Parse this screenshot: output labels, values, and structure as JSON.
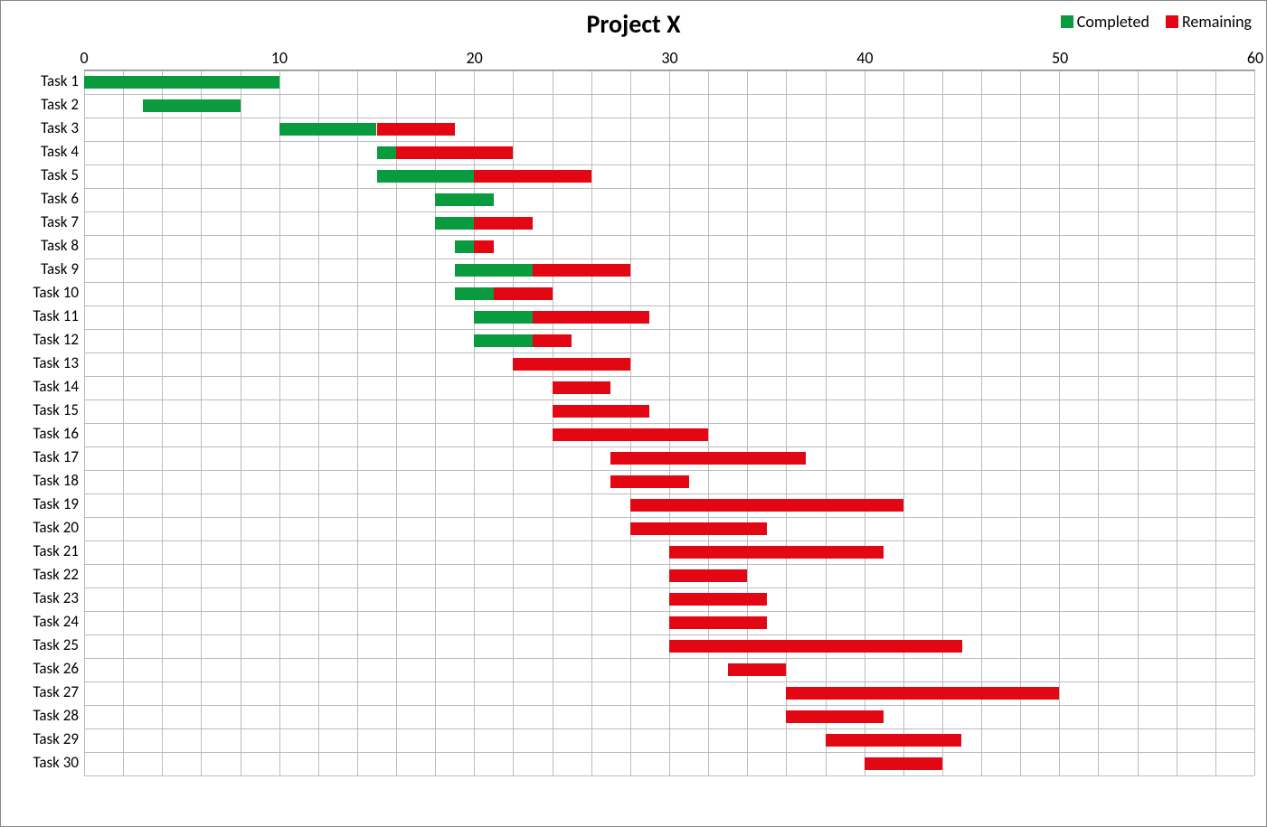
{
  "chart_data": {
    "type": "bar",
    "orientation": "horizontal_stacked_gantt",
    "title": "Project X",
    "xlabel": "",
    "ylabel": "",
    "xlim": [
      0,
      60
    ],
    "x_ticks": [
      0,
      10,
      20,
      30,
      40,
      50,
      60
    ],
    "x_minor_step": 2,
    "legend": [
      {
        "name": "Completed",
        "color": "#0a9b3e"
      },
      {
        "name": "Remaining",
        "color": "#e30613"
      }
    ],
    "categories": [
      "Task 1",
      "Task 2",
      "Task 3",
      "Task 4",
      "Task 5",
      "Task 6",
      "Task 7",
      "Task 8",
      "Task 9",
      "Task 10",
      "Task 11",
      "Task 12",
      "Task 13",
      "Task 14",
      "Task 15",
      "Task 16",
      "Task 17",
      "Task 18",
      "Task 19",
      "Task 20",
      "Task 21",
      "Task 22",
      "Task 23",
      "Task 24",
      "Task 25",
      "Task 26",
      "Task 27",
      "Task 28",
      "Task 29",
      "Task 30"
    ],
    "tasks": [
      {
        "name": "Task 1",
        "start": 0,
        "completed": 10,
        "remaining": 0
      },
      {
        "name": "Task 2",
        "start": 3,
        "completed": 5,
        "remaining": 0
      },
      {
        "name": "Task 3",
        "start": 10,
        "completed": 5,
        "remaining": 4
      },
      {
        "name": "Task 4",
        "start": 15,
        "completed": 1,
        "remaining": 6
      },
      {
        "name": "Task 5",
        "start": 15,
        "completed": 5,
        "remaining": 6
      },
      {
        "name": "Task 6",
        "start": 18,
        "completed": 3,
        "remaining": 0
      },
      {
        "name": "Task 7",
        "start": 18,
        "completed": 2,
        "remaining": 3
      },
      {
        "name": "Task 8",
        "start": 19,
        "completed": 1,
        "remaining": 1
      },
      {
        "name": "Task 9",
        "start": 19,
        "completed": 4,
        "remaining": 5
      },
      {
        "name": "Task 10",
        "start": 19,
        "completed": 2,
        "remaining": 3
      },
      {
        "name": "Task 11",
        "start": 20,
        "completed": 3,
        "remaining": 6
      },
      {
        "name": "Task 12",
        "start": 20,
        "completed": 3,
        "remaining": 2
      },
      {
        "name": "Task 13",
        "start": 22,
        "completed": 0,
        "remaining": 6
      },
      {
        "name": "Task 14",
        "start": 24,
        "completed": 0,
        "remaining": 3
      },
      {
        "name": "Task 15",
        "start": 24,
        "completed": 0,
        "remaining": 5
      },
      {
        "name": "Task 16",
        "start": 24,
        "completed": 0,
        "remaining": 8
      },
      {
        "name": "Task 17",
        "start": 27,
        "completed": 0,
        "remaining": 10
      },
      {
        "name": "Task 18",
        "start": 27,
        "completed": 0,
        "remaining": 4
      },
      {
        "name": "Task 19",
        "start": 28,
        "completed": 0,
        "remaining": 14
      },
      {
        "name": "Task 20",
        "start": 28,
        "completed": 0,
        "remaining": 7
      },
      {
        "name": "Task 21",
        "start": 30,
        "completed": 0,
        "remaining": 11
      },
      {
        "name": "Task 22",
        "start": 30,
        "completed": 0,
        "remaining": 4
      },
      {
        "name": "Task 23",
        "start": 30,
        "completed": 0,
        "remaining": 5
      },
      {
        "name": "Task 24",
        "start": 30,
        "completed": 0,
        "remaining": 5
      },
      {
        "name": "Task 25",
        "start": 30,
        "completed": 0,
        "remaining": 15
      },
      {
        "name": "Task 26",
        "start": 33,
        "completed": 0,
        "remaining": 3
      },
      {
        "name": "Task 27",
        "start": 36,
        "completed": 0,
        "remaining": 14
      },
      {
        "name": "Task 28",
        "start": 36,
        "completed": 0,
        "remaining": 5
      },
      {
        "name": "Task 29",
        "start": 38,
        "completed": 0,
        "remaining": 7
      },
      {
        "name": "Task 30",
        "start": 40,
        "completed": 0,
        "remaining": 4
      }
    ]
  }
}
